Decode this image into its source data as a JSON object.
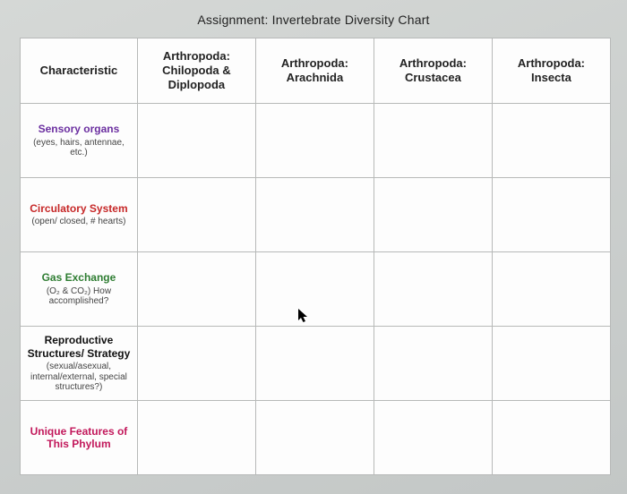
{
  "title": "Assignment: Invertebrate Diversity Chart",
  "headers": {
    "c0": "Characteristic",
    "c1": "Arthropoda: Chilopoda & Diplopoda",
    "c2": "Arthropoda: Arachnida",
    "c3": "Arthropoda: Crustacea",
    "c4": "Arthropoda: Insecta"
  },
  "rows": [
    {
      "label": "Sensory organs",
      "sub": "(eyes, hairs, antennae, etc.)",
      "colorClass": "c-purple",
      "cells": [
        "",
        "",
        "",
        ""
      ]
    },
    {
      "label": "Circulatory System",
      "sub": "(open/ closed, # hearts)",
      "colorClass": "c-red",
      "cells": [
        "",
        "",
        "",
        ""
      ]
    },
    {
      "label": "Gas Exchange",
      "sub": "(O₂ & CO₂) How accomplished?",
      "colorClass": "c-green",
      "cells": [
        "",
        "",
        "",
        ""
      ]
    },
    {
      "label": "Reproductive Structures/ Strategy",
      "sub": "(sexual/asexual, internal/external, special structures?)",
      "colorClass": "c-black",
      "cells": [
        "",
        "",
        "",
        ""
      ]
    },
    {
      "label": "Unique Features of This Phylum",
      "sub": "",
      "colorClass": "c-magenta",
      "cells": [
        "",
        "",
        "",
        ""
      ]
    }
  ],
  "chart_data": {
    "type": "table",
    "title": "Assignment: Invertebrate Diversity Chart",
    "columns": [
      "Characteristic",
      "Arthropoda: Chilopoda & Diplopoda",
      "Arthropoda: Arachnida",
      "Arthropoda: Crustacea",
      "Arthropoda: Insecta"
    ],
    "rows": [
      [
        "Sensory organs (eyes, hairs, antennae, etc.)",
        "",
        "",
        "",
        ""
      ],
      [
        "Circulatory System (open/ closed, # hearts)",
        "",
        "",
        "",
        ""
      ],
      [
        "Gas Exchange (O2 & CO2) How accomplished?",
        "",
        "",
        "",
        ""
      ],
      [
        "Reproductive Structures/ Strategy (sexual/asexual, internal/external, special structures?)",
        "",
        "",
        "",
        ""
      ],
      [
        "Unique Features of This Phylum",
        "",
        "",
        "",
        ""
      ]
    ]
  }
}
